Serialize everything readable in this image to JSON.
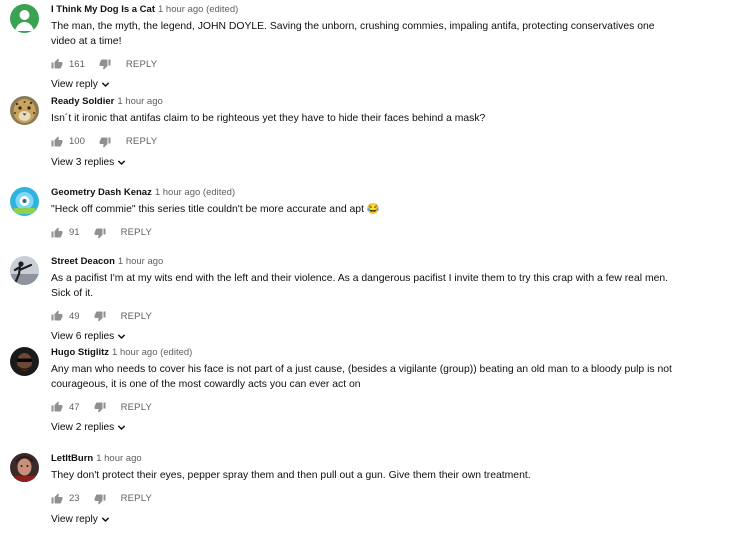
{
  "comments": [
    {
      "author": "I Think My Dog Is a Cat",
      "meta": "1 hour ago (edited)",
      "text": "The man, the myth, the legend, JOHN DOYLE. Saving the unborn, crushing commies, impaling antifa, protecting conservatives one video at a time!",
      "likes": "161",
      "reply_label": "REPLY",
      "replies_label": "View reply",
      "avatar_icon": "default-user-avatar-icon"
    },
    {
      "author": "Ready Soldier",
      "meta": "1 hour ago",
      "text": "Isn´t it ironic that antifas claim to be righteous yet they have to hide their faces behind a mask?",
      "likes": "100",
      "reply_label": "REPLY",
      "replies_label": "View 3 replies",
      "avatar_icon": "leopard-avatar-icon"
    },
    {
      "author": "Geometry Dash Kenaz",
      "meta": "1 hour ago (edited)",
      "text": "\"Heck off commie\" this series title couldn't be more accurate and apt",
      "emoji": "😂",
      "likes": "91",
      "reply_label": "REPLY",
      "avatar_icon": "cartoon-avatar-icon"
    },
    {
      "author": "Street Deacon",
      "meta": "1 hour ago",
      "text": "As a pacifist I'm at my wits end with the left and their violence. As a dangerous pacifist I invite them to try this crap with a few real men. Sick of it.",
      "likes": "49",
      "reply_label": "REPLY",
      "replies_label": "View 6 replies",
      "avatar_icon": "kick-silhouette-avatar-icon"
    },
    {
      "author": "Hugo Stiglitz",
      "meta": "1 hour ago (edited)",
      "text": "Any man who needs to cover his face is not part of a just cause, (besides a vigilante (group)) beating an old man to a bloody pulp is not courageous, it is one of the most cowardly acts you can ever act on",
      "likes": "47",
      "reply_label": "REPLY",
      "replies_label": "View 2 replies",
      "avatar_icon": "sunglasses-man-avatar-icon"
    },
    {
      "author": "LetItBurn",
      "meta": "1 hour ago",
      "text": "They don't protect their eyes, pepper spray them and then pull out a gun. Give them their own treatment.",
      "likes": "23",
      "reply_label": "REPLY",
      "replies_label": "View reply",
      "avatar_icon": "portrait-avatar-icon"
    }
  ]
}
